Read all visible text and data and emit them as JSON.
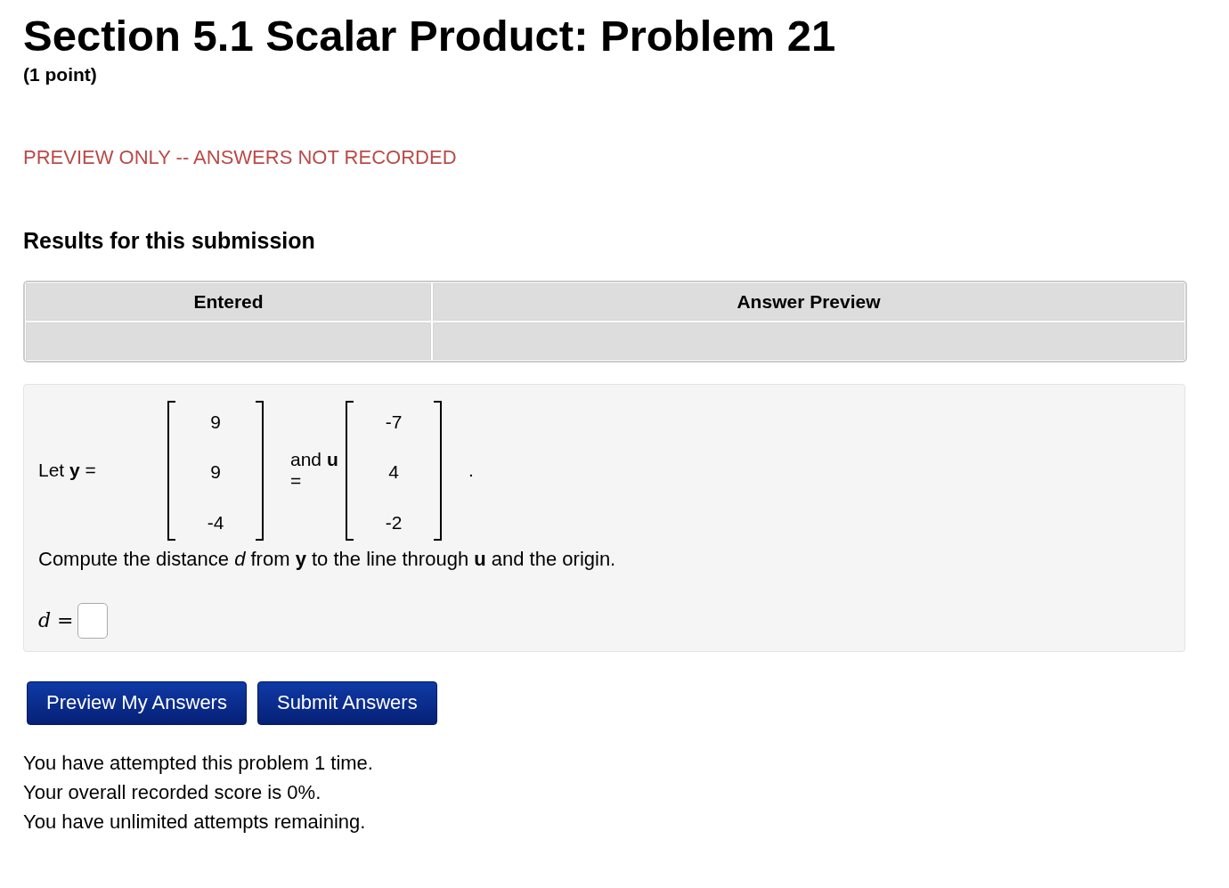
{
  "title": "Section 5.1 Scalar Product: Problem 21",
  "points": "(1 point)",
  "notice": "PREVIEW ONLY -- ANSWERS NOT RECORDED",
  "results_heading": "Results for this submission",
  "results_table": {
    "columns": [
      "Entered",
      "Answer Preview"
    ]
  },
  "problem": {
    "parts": [
      {
        "kind": "text",
        "text": "Let **y** ="
      },
      {
        "kind": "matrix",
        "entries": [
          "9",
          "9",
          "-4"
        ]
      },
      {
        "kind": "text",
        "text": "and **u** ="
      },
      {
        "kind": "matrix",
        "entries": [
          "-7",
          "4",
          "-2"
        ]
      },
      {
        "kind": "text",
        "text": "."
      }
    ],
    "question": "Compute the distance *d* from **y** to the line through **u** and the origin.",
    "answer_label": "*d* ="
  },
  "buttons": [
    "Preview My Answers",
    "Submit Answers"
  ],
  "status_lines": [
    "You have attempted this problem 1 time.",
    "Your overall recorded score is 0%.",
    "You have unlimited attempts remaining."
  ]
}
